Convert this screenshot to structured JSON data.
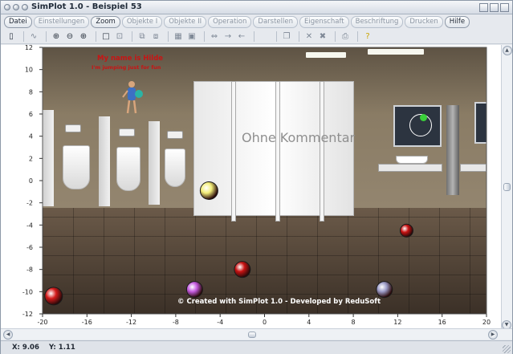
{
  "window": {
    "title": "SimPlot 1.0 - Beispiel 53"
  },
  "menu": [
    {
      "label": "Datei",
      "active": true
    },
    {
      "label": "Einstellungen",
      "active": false
    },
    {
      "label": "Zoom",
      "active": true
    },
    {
      "label": "Objekte I",
      "active": false
    },
    {
      "label": "Objekte II",
      "active": false
    },
    {
      "label": "Operation",
      "active": false
    },
    {
      "label": "Darstellen",
      "active": false
    },
    {
      "label": "Eigenschaft",
      "active": false
    },
    {
      "label": "Beschriftung",
      "active": false
    },
    {
      "label": "Drucken",
      "active": false
    },
    {
      "label": "Hilfe",
      "active": true
    }
  ],
  "scene_text": {
    "name_line1": "My name is Hilde",
    "name_line2": "I'm jumping just for fun",
    "comment": "Ohne Kommentar",
    "credit": "© Created with SimPlot 1.0 - Developed by ReduSoft"
  },
  "axes": {
    "x_ticks": [
      "-20",
      "-16",
      "-12",
      "-8",
      "-4",
      "0",
      "4",
      "8",
      "12",
      "16",
      "20"
    ],
    "y_ticks": [
      "12",
      "10",
      "8",
      "6",
      "4",
      "2",
      "0",
      "-2",
      "-4",
      "-6",
      "-8",
      "-10",
      "-12"
    ],
    "xlim": [
      -20,
      20
    ],
    "ylim": [
      -12,
      12
    ]
  },
  "balls": [
    {
      "x": -19,
      "y": -10.4,
      "color": "#d41a1a"
    },
    {
      "x": -5,
      "y": -0.9,
      "color": "#f3ef7a"
    },
    {
      "x": -6.3,
      "y": -9.8,
      "color": "#c45be0"
    },
    {
      "x": -2,
      "y": -8,
      "color": "#c81212"
    },
    {
      "x": 10.8,
      "y": -9.8,
      "color": "#9c9cc8"
    },
    {
      "x": 12.8,
      "y": -4.5,
      "color": "#c81212"
    }
  ],
  "status": {
    "x": "X: 9.06",
    "y": "Y: 1.11"
  }
}
